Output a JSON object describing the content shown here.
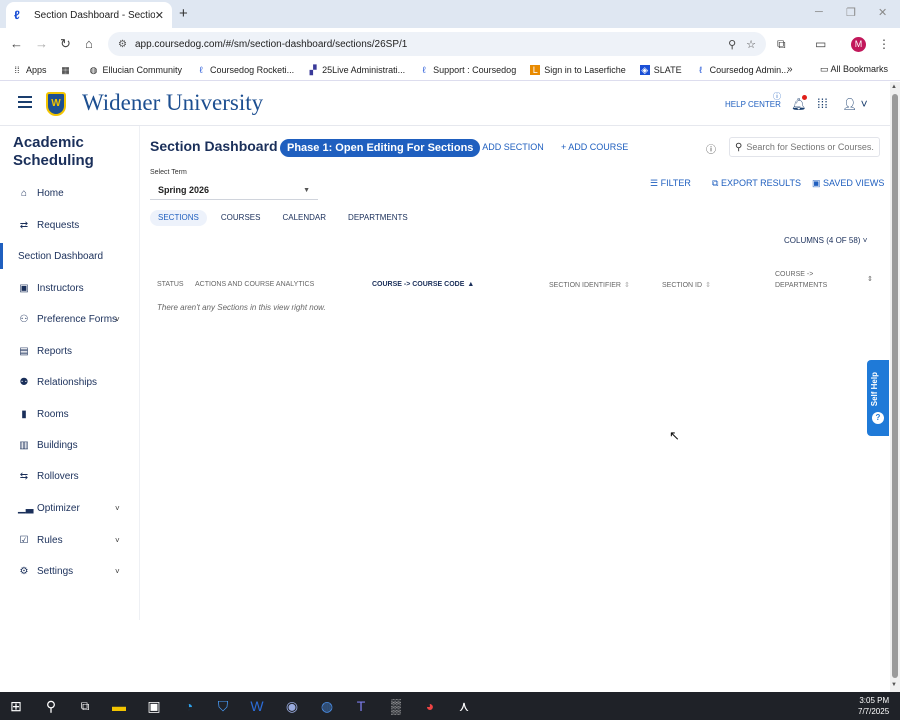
{
  "browser": {
    "tab_title": "Section Dashboard - Sections",
    "tab_close": "✕",
    "new_tab": "+",
    "url": "app.coursedog.com/#/sm/section-dashboard/sections/26SP/1",
    "window_controls": [
      "─",
      "❐",
      "✕"
    ]
  },
  "bookmarks": {
    "items": [
      {
        "label": "Apps",
        "icon": "apps-grid-icon"
      },
      {
        "label": "",
        "icon": "tab-groups-icon"
      },
      {
        "label": "Ellucian Community",
        "icon": "globe-icon"
      },
      {
        "label": "Coursedog Rocketi...",
        "icon": "coursedog-icon"
      },
      {
        "label": "25Live Administrati...",
        "icon": "25live-icon"
      },
      {
        "label": "Support : Coursedog",
        "icon": "coursedog-icon"
      },
      {
        "label": "Sign in to Laserfiche",
        "icon": "laserfiche-icon"
      },
      {
        "label": "SLATE",
        "icon": "slate-icon"
      },
      {
        "label": "Coursedog Admin...",
        "icon": "coursedog-icon"
      }
    ],
    "more": "»",
    "all_bookmarks": "All Bookmarks"
  },
  "header": {
    "university_name": "Widener University",
    "help_center": "HELP CENTER"
  },
  "sidebar": {
    "title": "Academic Scheduling",
    "items": [
      {
        "label": "Home",
        "icon": "home-icon",
        "glyph": "⌂"
      },
      {
        "label": "Requests",
        "icon": "requests-icon",
        "glyph": "⇄"
      },
      {
        "label": "Section Dashboard",
        "icon": "",
        "glyph": "",
        "active": true
      },
      {
        "label": "Instructors",
        "icon": "instructor-icon",
        "glyph": "▣"
      },
      {
        "label": "Preference Forms",
        "icon": "people-icon",
        "glyph": "⚇",
        "chevron": true
      },
      {
        "label": "Reports",
        "icon": "reports-icon",
        "glyph": "▤"
      },
      {
        "label": "Relationships",
        "icon": "relationships-icon",
        "glyph": "⚉"
      },
      {
        "label": "Rooms",
        "icon": "door-icon",
        "glyph": "▮"
      },
      {
        "label": "Buildings",
        "icon": "building-icon",
        "glyph": "▥"
      },
      {
        "label": "Rollovers",
        "icon": "rollover-icon",
        "glyph": "⇆"
      },
      {
        "label": "Optimizer",
        "icon": "bar-chart-icon",
        "glyph": "▁▃",
        "chevron": true
      },
      {
        "label": "Rules",
        "icon": "checkbox-icon",
        "glyph": "☑",
        "chevron": true
      },
      {
        "label": "Settings",
        "icon": "gear-icon",
        "glyph": "⚙",
        "chevron": true
      }
    ]
  },
  "main": {
    "page_title": "Section Dashboard",
    "phase_badge": "Phase 1: Open Editing For Sections",
    "add_section": "+ ADD SECTION",
    "add_course": "+ ADD COURSE",
    "search_placeholder": "Search for Sections or Courses...",
    "term_label": "Select Term",
    "term_value": "Spring 2026",
    "filter": "FILTER",
    "export_results": "EXPORT RESULTS",
    "saved_views": "SAVED VIEWS",
    "tabs": [
      "SECTIONS",
      "COURSES",
      "CALENDAR",
      "DEPARTMENTS"
    ],
    "columns_button": "COLUMNS (4 OF 58)",
    "table_headers": {
      "status": "STATUS",
      "actions": "ACTIONS AND COURSE ANALYTICS",
      "course_code": "COURSE -> COURSE CODE",
      "section_identifier": "SECTION IDENTIFIER",
      "section_id": "SECTION ID",
      "course_departments_1": "COURSE ->",
      "course_departments_2": "DEPARTMENTS"
    },
    "empty_message": "There aren't any Sections in this view right now."
  },
  "self_help": {
    "label": "Self Help",
    "icon": "?"
  },
  "taskbar": {
    "time": "3:05 PM",
    "date": "7/7/2025"
  },
  "colors": {
    "brand_blue": "#1d4f91",
    "accent_blue": "#1f5fbf",
    "shield_gold": "#f2c400",
    "notification_red": "#e0201a",
    "taskbar": "#1f2228"
  }
}
